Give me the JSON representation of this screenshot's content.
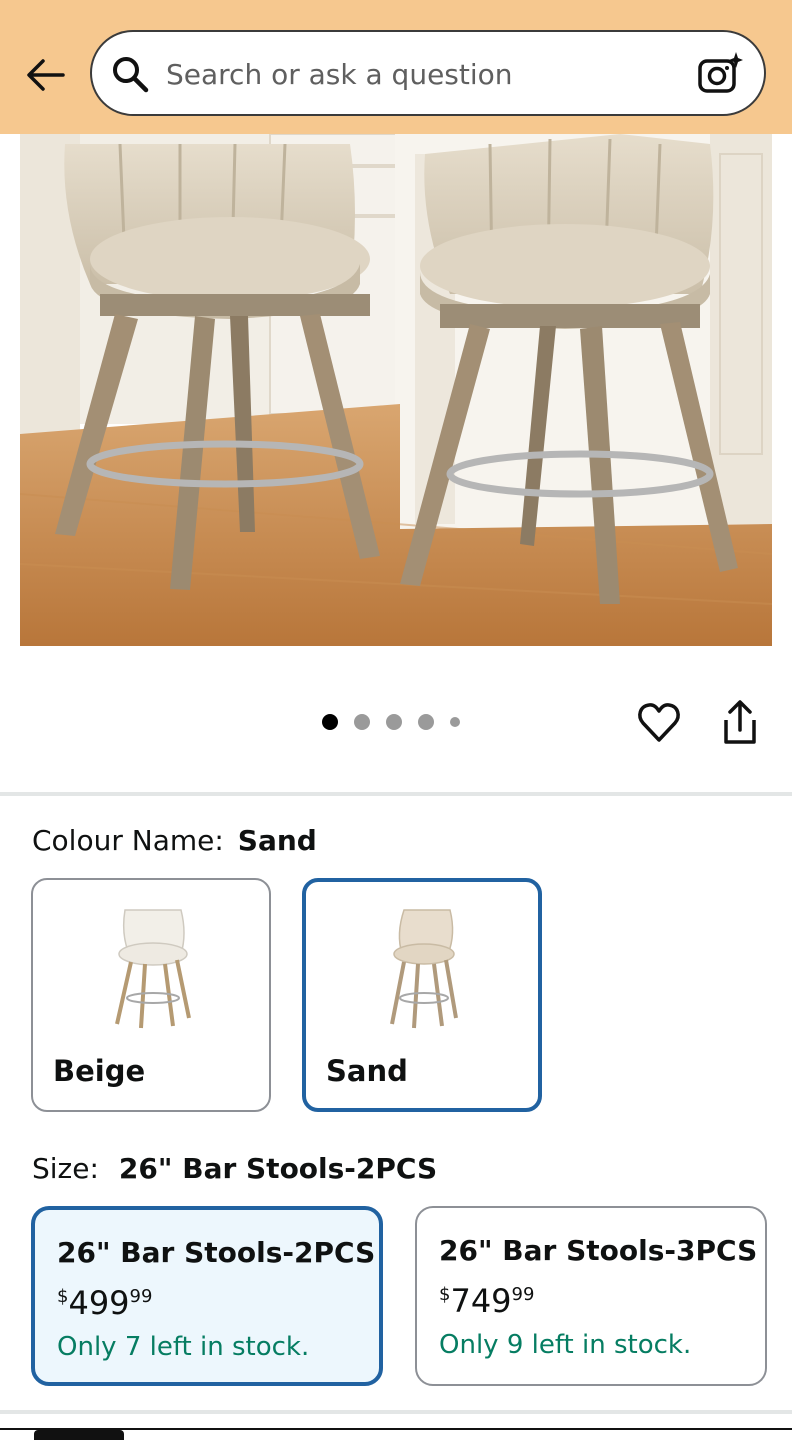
{
  "header": {
    "search_placeholder": "Search or ask a question"
  },
  "carousel": {
    "total_images": 5,
    "active_index": 0
  },
  "colour": {
    "label": "Colour Name:",
    "selected": "Sand",
    "options": [
      {
        "name": "Beige",
        "selected": false
      },
      {
        "name": "Sand",
        "selected": true
      }
    ]
  },
  "size": {
    "label": "Size:",
    "selected": "26\" Bar Stools-2PCS",
    "options": [
      {
        "title": "26\" Bar Stools-2PCS",
        "currency": "$",
        "price_whole": "499",
        "price_fraction": "99",
        "stock": "Only 7 left in stock.",
        "selected": true
      },
      {
        "title": "26\" Bar Stools-3PCS",
        "currency": "$",
        "price_whole": "749",
        "price_fraction": "99",
        "stock": "Only 9 left in stock.",
        "selected": false
      }
    ]
  },
  "colors": {
    "header_bg": "#f6c88f",
    "selected_border": "#2162a1",
    "selected_bg": "#edf7fd",
    "stock_green": "#067d62"
  }
}
